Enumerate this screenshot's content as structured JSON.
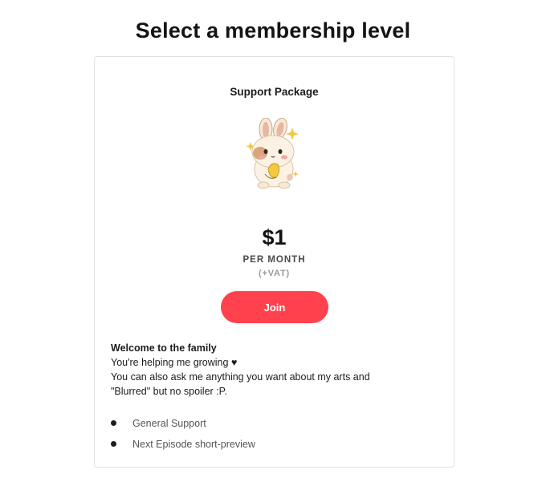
{
  "page": {
    "title": "Select a membership level"
  },
  "tier": {
    "name": "Support Package",
    "image_icon": "bunny-illustration",
    "price": "$1",
    "period": "PER MONTH",
    "tax_note": "(+VAT)",
    "join_label": "Join",
    "accent_color": "#ff424d",
    "description": {
      "heading": "Welcome to the family",
      "lines": [
        "You're helping me growing ♥",
        "You can also ask me anything you want about my arts and",
        "\"Blurred\" but no spoiler :P."
      ]
    },
    "benefits": [
      "General Support",
      "Next Episode short-preview"
    ]
  }
}
